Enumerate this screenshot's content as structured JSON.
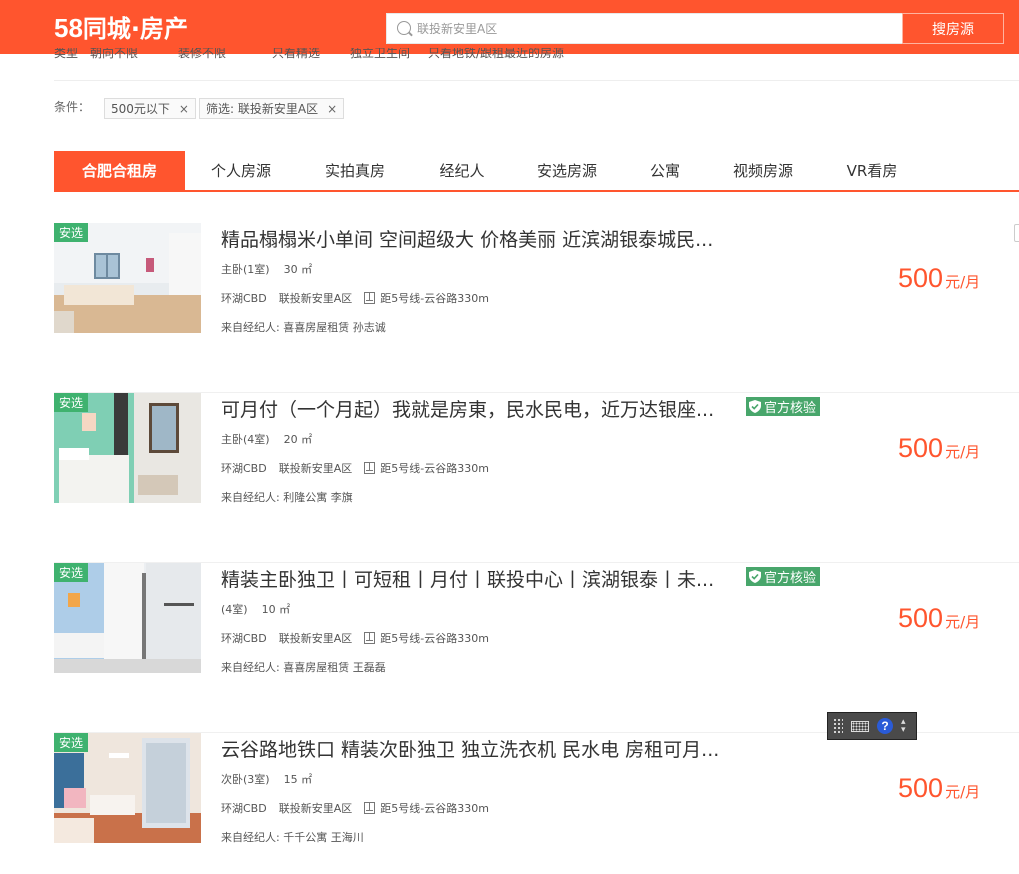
{
  "header": {
    "logo_num": "58",
    "logo_text": "同城·房产",
    "search_placeholder": "联投新安里A区",
    "search_button": "搜房源",
    "brand_color": "#ff552e"
  },
  "filter_row_partial": [
    "类型",
    "朝向不限",
    "装修不限",
    "只看精选",
    "独立卫生间",
    "只看地铁/跟租最近的房源"
  ],
  "conditions": {
    "label": "条件：",
    "tags": [
      {
        "text": "500元以下",
        "remove": "×"
      },
      {
        "text": "筛选: 联投新安里A区",
        "remove": "×"
      }
    ]
  },
  "tabs": [
    {
      "label": "合肥合租房",
      "active": true
    },
    {
      "label": "个人房源"
    },
    {
      "label": "实拍真房"
    },
    {
      "label": "经纪人"
    },
    {
      "label": "安选房源"
    },
    {
      "label": "公寓"
    },
    {
      "label": "视频房源"
    },
    {
      "label": "VR看房"
    }
  ],
  "listings": [
    {
      "badge": "安选",
      "title": "精品榻榻米小单间 空间超级大 价格美丽 近滨湖银泰城民...",
      "verified": "",
      "room": "主卧(1室)",
      "area": "30 ㎡",
      "district": "环湖CBD",
      "community": "联投新安里A区",
      "metro": "距5号线-云谷路330m",
      "agent": "来自经纪人: 喜喜房屋租赁 孙志诚",
      "price": "500",
      "unit": "元/月"
    },
    {
      "badge": "安选",
      "title": "可月付（一个月起）我就是房東，民水民电，近万达银座...",
      "verified": "官方核验",
      "room": "主卧(4室)",
      "area": "20 ㎡",
      "district": "环湖CBD",
      "community": "联投新安里A区",
      "metro": "距5号线-云谷路330m",
      "agent": "来自经纪人: 利隆公寓 李旗",
      "price": "500",
      "unit": "元/月"
    },
    {
      "badge": "安选",
      "title": "精装主卧独卫丨可短租丨月付丨联投中心丨滨湖银泰丨未...",
      "verified": "官方核验",
      "room": "(4室)",
      "area": "10 ㎡",
      "district": "环湖CBD",
      "community": "联投新安里A区",
      "metro": "距5号线-云谷路330m",
      "agent": "来自经纪人: 喜喜房屋租赁 王磊磊",
      "price": "500",
      "unit": "元/月"
    },
    {
      "badge": "安选",
      "title": "云谷路地铁口 精装次卧独卫 独立洗衣机 民水电 房租可月...",
      "verified": "",
      "room": "次卧(3室)",
      "area": "15 ㎡",
      "district": "环湖CBD",
      "community": "联投新安里A区",
      "metro": "距5号线-云谷路330m",
      "agent": "来自经纪人: 千千公寓 王海川",
      "price": "500",
      "unit": "元/月"
    }
  ],
  "ime_widget": {
    "help": "?"
  }
}
